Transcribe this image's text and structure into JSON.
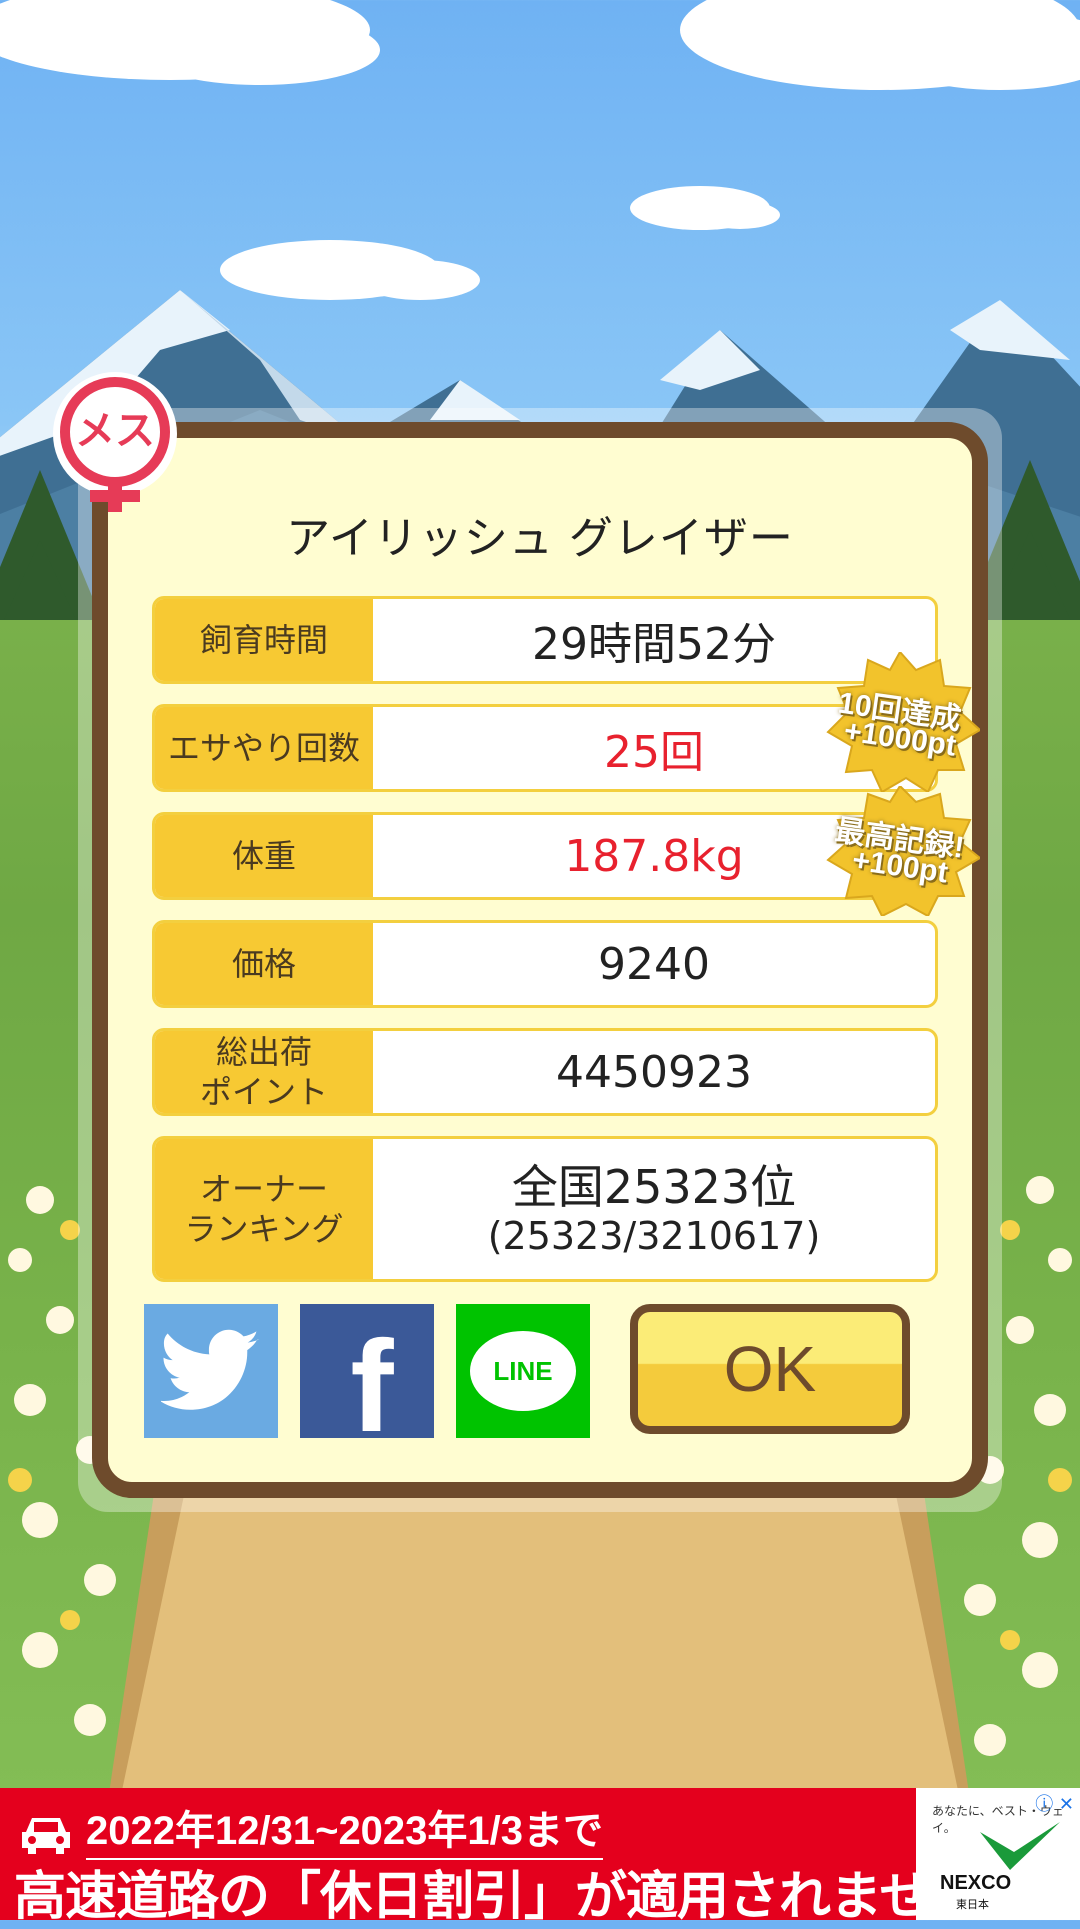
{
  "gender_badge": "メス",
  "title": "アイリッシュ グレイザー",
  "stats": {
    "rows": [
      {
        "label": "飼育時間",
        "value": "29時間52分"
      },
      {
        "label": "エサやり回数",
        "value": "25回"
      },
      {
        "label": "体重",
        "value": "187.8kg"
      },
      {
        "label": "価格",
        "value": "9240"
      },
      {
        "label": "総出荷\nポイント",
        "value": "4450923"
      }
    ],
    "ranking": {
      "label": "オーナー\nランキング",
      "rank": "全国25323位",
      "detail": "(25323/3210617)"
    }
  },
  "achievements": [
    {
      "line1": "10回達成",
      "line2": "+1000pt"
    },
    {
      "line1": "最高記録!",
      "line2": "+100pt"
    }
  ],
  "share": {
    "twitter": "Twitter",
    "facebook": "f",
    "line": "LINE"
  },
  "ok_label": "OK",
  "ad": {
    "line1": "2022年12/31~2023年1/3まで",
    "line2": "高速道路の「休日割引」が適用されません",
    "tagline": "あなたに、ベスト・ウェイ。",
    "brand": "NEXCO",
    "brand_sub": "東日本",
    "controls": "ⓘ ✕"
  },
  "colors": {
    "accent_yellow": "#f7c933",
    "frame_brown": "#6e4b2c",
    "highlight_red": "#e8212e",
    "ad_red": "#e4001d"
  }
}
